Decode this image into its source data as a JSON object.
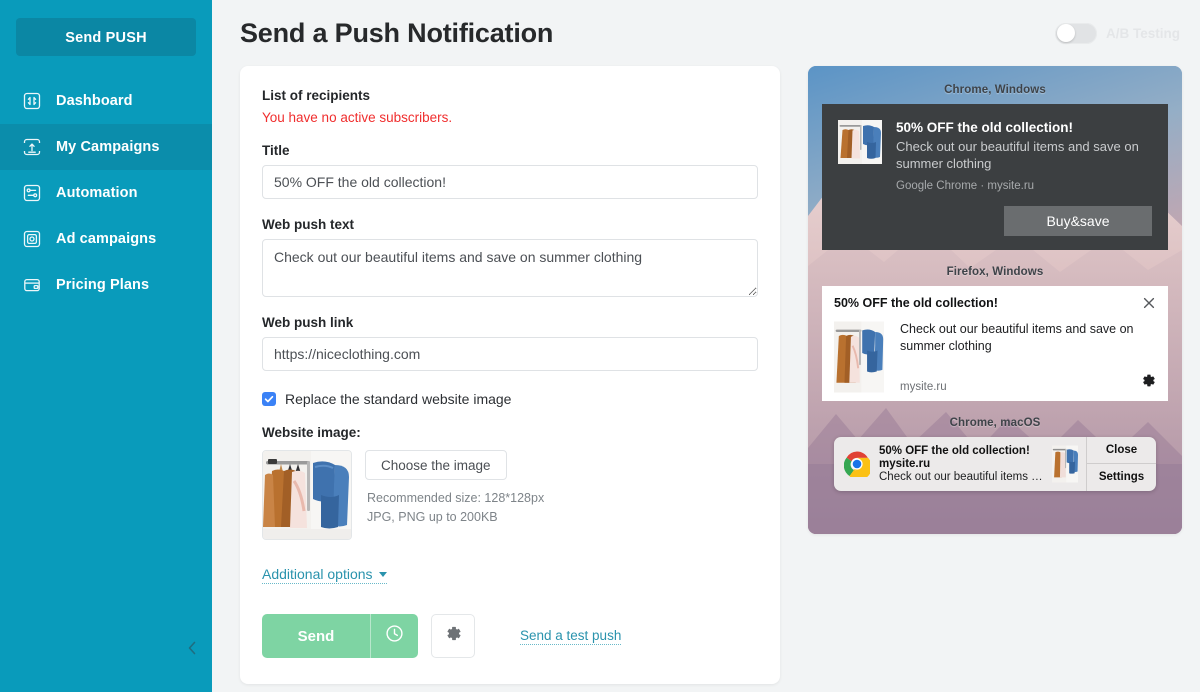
{
  "sidebar": {
    "send_push_label": "Send PUSH",
    "items": [
      {
        "label": "Dashboard",
        "icon": "dashboard-icon",
        "active": false
      },
      {
        "label": "My Campaigns",
        "icon": "campaigns-icon",
        "active": true
      },
      {
        "label": "Automation",
        "icon": "automation-icon",
        "active": false
      },
      {
        "label": "Ad campaigns",
        "icon": "ad-campaigns-icon",
        "active": false
      },
      {
        "label": "Pricing Plans",
        "icon": "pricing-icon",
        "active": false
      }
    ],
    "collapse_icon": "chevron-left-icon",
    "bg_color": "#099bbb",
    "active_color": "#0b8dab"
  },
  "header": {
    "title": "Send a Push Notification",
    "ab_testing_label": "A/B Testing",
    "ab_testing_on": false
  },
  "form": {
    "recipients_label": "List of recipients",
    "recipients_error": "You have no active subscribers.",
    "title_label": "Title",
    "title_value": "50% OFF the old collection!",
    "text_label": "Web push text",
    "text_value": "Check out our beautiful items and save on summer clothing",
    "link_label": "Web push link",
    "link_value": "https://niceclothing.com",
    "replace_image_label": "Replace the standard website image",
    "replace_image_checked": true,
    "website_image_label": "Website image:",
    "choose_image_label": "Choose the image",
    "hint_line1": "Recommended size: 128*128px",
    "hint_line2": "JPG, PNG up to 200KB",
    "additional_options_label": "Additional options",
    "send_label": "Send",
    "schedule_icon": "clock-icon",
    "settings_icon": "gear-icon",
    "test_push_label": "Send a test push",
    "send_button_color": "#7ed4a3",
    "error_color": "#f02e2e",
    "link_color": "#2a93ad",
    "checkbox_color": "#3b82f6"
  },
  "preview": {
    "chrome_windows": {
      "caption": "Chrome, Windows",
      "title": "50% OFF the old collection!",
      "text": "Check out our beautiful items and save on summer clothing",
      "meta": "Google Chrome · mysite.ru",
      "button_label": "Buy&save"
    },
    "firefox_windows": {
      "caption": "Firefox, Windows",
      "title": "50% OFF the old collection!",
      "text": "Check out our beautiful items and save on summer clothing",
      "site": "mysite.ru",
      "close_icon": "close-icon",
      "settings_icon": "gear-icon"
    },
    "chrome_macos": {
      "caption": "Chrome, macOS",
      "title": "50% OFF the old collection!",
      "site": "mysite.ru",
      "text": "Check out our beautiful items a…",
      "close_label": "Close",
      "settings_label": "Settings",
      "logo_icon": "chrome-logo-icon"
    }
  }
}
